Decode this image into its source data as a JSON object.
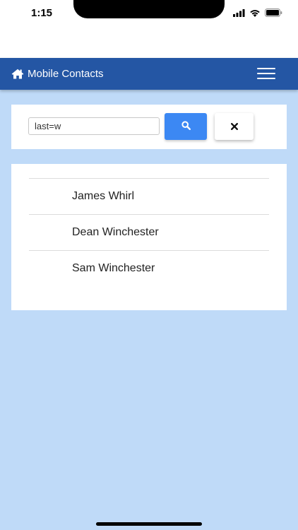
{
  "status_bar": {
    "time": "1:15",
    "icons": [
      "signal-icon",
      "wifi-icon",
      "battery-icon"
    ]
  },
  "navbar": {
    "brand_icon": "home-icon",
    "brand_label": "Mobile Contacts",
    "menu_icon": "hamburger-menu-icon",
    "background": "#2456a4"
  },
  "search": {
    "value": "last=w",
    "placeholder": "",
    "search_button_icon": "search-icon",
    "search_button_color": "#3c88f3",
    "clear_button_icon": "close-icon"
  },
  "contacts": [
    {
      "name": "James Whirl"
    },
    {
      "name": "Dean Winchester"
    },
    {
      "name": "Sam Winchester"
    }
  ],
  "colors": {
    "page_background": "#bfdaf8",
    "card_background": "#ffffff"
  }
}
